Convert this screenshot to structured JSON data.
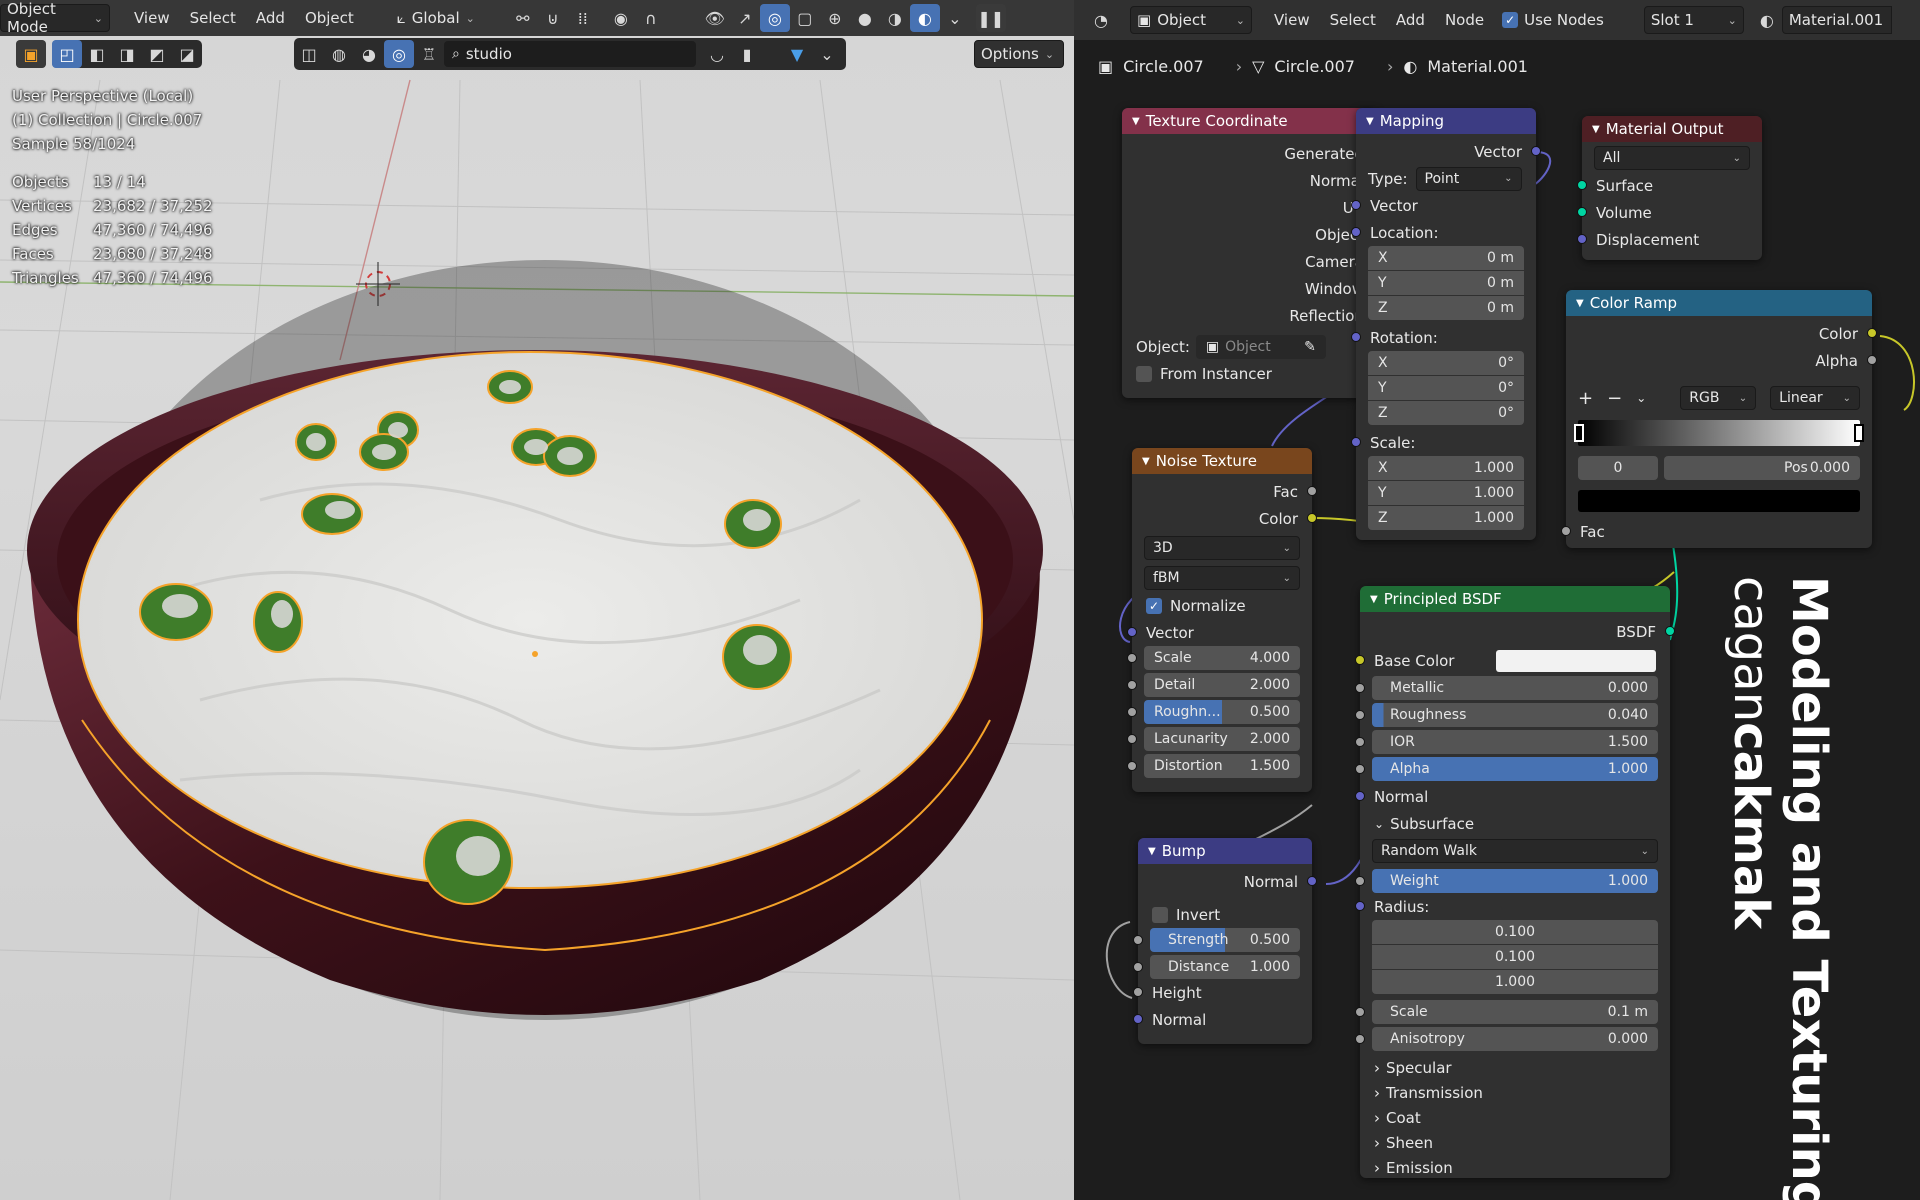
{
  "viewport_header": {
    "mode": "Object Mode",
    "menus": [
      "View",
      "Select",
      "Add",
      "Object"
    ],
    "transform_orientation": "Global",
    "search_value": "studio",
    "options_label": "Options"
  },
  "viewport_overlay": {
    "perspective": "User Perspective (Local)",
    "collection": "(1) Collection | Circle.007",
    "sample": "Sample 58/1024",
    "stats": [
      {
        "label": "Objects",
        "value": "13 / 14"
      },
      {
        "label": "Vertices",
        "value": "23,682 / 37,252"
      },
      {
        "label": "Edges",
        "value": "47,360 / 74,496"
      },
      {
        "label": "Faces",
        "value": "23,680 / 37,248"
      },
      {
        "label": "Triangles",
        "value": "47,360 / 74,496"
      }
    ]
  },
  "node_header": {
    "object_selector": "Object",
    "menus": [
      "View",
      "Select",
      "Add",
      "Node"
    ],
    "use_nodes_label": "Use Nodes",
    "slot": "Slot 1",
    "material": "Material.001"
  },
  "breadcrumb": [
    "Circle.007",
    "Circle.007",
    "Material.001"
  ],
  "nodes": {
    "texcoord": {
      "title": "Texture Coordinate",
      "outputs": [
        "Generated",
        "Normal",
        "UV",
        "Object",
        "Camera",
        "Window",
        "Reflection"
      ],
      "object_label": "Object:",
      "object_placeholder": "Object",
      "from_instancer": "From Instancer"
    },
    "mapping": {
      "title": "Mapping",
      "output": "Vector",
      "type_label": "Type:",
      "type_value": "Point",
      "vector_label": "Vector",
      "location_label": "Location:",
      "location": [
        {
          "a": "X",
          "v": "0 m"
        },
        {
          "a": "Y",
          "v": "0 m"
        },
        {
          "a": "Z",
          "v": "0 m"
        }
      ],
      "rotation_label": "Rotation:",
      "rotation": [
        {
          "a": "X",
          "v": "0°"
        },
        {
          "a": "Y",
          "v": "0°"
        },
        {
          "a": "Z",
          "v": "0°"
        }
      ],
      "scale_label": "Scale:",
      "scale": [
        {
          "a": "X",
          "v": "1.000"
        },
        {
          "a": "Y",
          "v": "1.000"
        },
        {
          "a": "Z",
          "v": "1.000"
        }
      ]
    },
    "output": {
      "title": "Material Output",
      "target": "All",
      "inputs": [
        "Surface",
        "Volume",
        "Displacement"
      ]
    },
    "ramp": {
      "title": "Color Ramp",
      "outputs": [
        "Color",
        "Alpha"
      ],
      "plus": "+",
      "minus": "−",
      "color_mode": "RGB",
      "interpolation": "Linear",
      "stop_index": "0",
      "pos_label": "Pos",
      "pos_value": "0.000",
      "input": "Fac"
    },
    "noise": {
      "title": "Noise Texture",
      "outputs": [
        "Fac",
        "Color"
      ],
      "dimensions": "3D",
      "type": "fBM",
      "normalize": "Normalize",
      "vector_label": "Vector",
      "fields": [
        {
          "k": "Scale",
          "v": "4.000"
        },
        {
          "k": "Detail",
          "v": "2.000"
        },
        {
          "k": "Roughn...",
          "v": "0.500"
        },
        {
          "k": "Lacunarity",
          "v": "2.000"
        },
        {
          "k": "Distortion",
          "v": "1.500"
        }
      ]
    },
    "bsdf": {
      "title": "Principled BSDF",
      "output": "BSDF",
      "base_color": "Base Color",
      "fields": [
        {
          "k": "Metallic",
          "v": "0.000"
        },
        {
          "k": "Roughness",
          "v": "0.040"
        },
        {
          "k": "IOR",
          "v": "1.500"
        },
        {
          "k": "Alpha",
          "v": "1.000"
        }
      ],
      "normal": "Normal",
      "subsurface": "Subsurface",
      "subsurface_method": "Random Walk",
      "weight_label": "Weight",
      "weight_value": "1.000",
      "radius_label": "Radius:",
      "radius": [
        "0.100",
        "0.100",
        "1.000"
      ],
      "scale_label": "Scale",
      "scale_value": "0.1 m",
      "aniso_label": "Anisotropy",
      "aniso_value": "0.000",
      "panels": [
        "Specular",
        "Transmission",
        "Coat",
        "Sheen",
        "Emission"
      ]
    },
    "bump": {
      "title": "Bump",
      "output": "Normal",
      "invert": "Invert",
      "strength_label": "Strength",
      "strength_value": "0.500",
      "distance_label": "Distance",
      "distance_value": "1.000",
      "height": "Height",
      "normal": "Normal"
    }
  },
  "credit": {
    "line1": "Modeling and Texturing:",
    "line2_light": "cagan",
    "line2_bold": "cakmak"
  },
  "colors": {
    "accent_blue": "#4772b3",
    "sand": "#e6e6e4",
    "bowl": "#4a1a24",
    "selection": "#f5a32a"
  }
}
